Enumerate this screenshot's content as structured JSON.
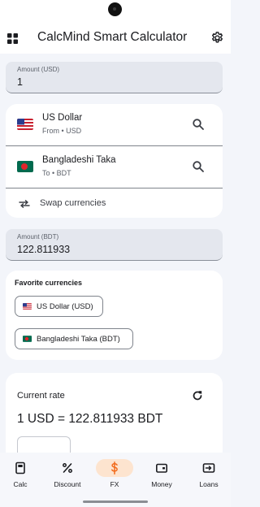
{
  "app": {
    "title": "CalcMind Smart Calculator"
  },
  "amount_input": {
    "label": "Amount (USD)",
    "value": "1"
  },
  "from_currency": {
    "name": "US Dollar",
    "sub": "From • USD",
    "flag": "us-flag"
  },
  "to_currency": {
    "name": "Bangladeshi Taka",
    "sub": "To • BDT",
    "flag": "bd-flag"
  },
  "swap": {
    "label": "Swap currencies"
  },
  "amount_output": {
    "label": "Amount (BDT)",
    "value": "122.811933"
  },
  "favorites": {
    "title": "Favorite currencies",
    "chips": [
      {
        "label": "US Dollar (USD)",
        "flag": "us-flag"
      },
      {
        "label": "Bangladeshi Taka (BDT)",
        "flag": "bd-flag"
      }
    ]
  },
  "rate": {
    "title": "Current rate",
    "value": "1 USD = 122.811933 BDT"
  },
  "nav": {
    "items": [
      {
        "label": "Calc",
        "icon": "calculator-icon"
      },
      {
        "label": "Discount",
        "icon": "percent-icon"
      },
      {
        "label": "FX",
        "icon": "dollar-icon",
        "active": true
      },
      {
        "label": "Money",
        "icon": "wallet-icon"
      },
      {
        "label": "Loans",
        "icon": "loan-icon"
      }
    ]
  },
  "colors": {
    "accent": "#f26a1b",
    "active_pill": "#fde4cf",
    "field_bg": "#e4e7ee",
    "page_bg": "#f3f5fa"
  }
}
